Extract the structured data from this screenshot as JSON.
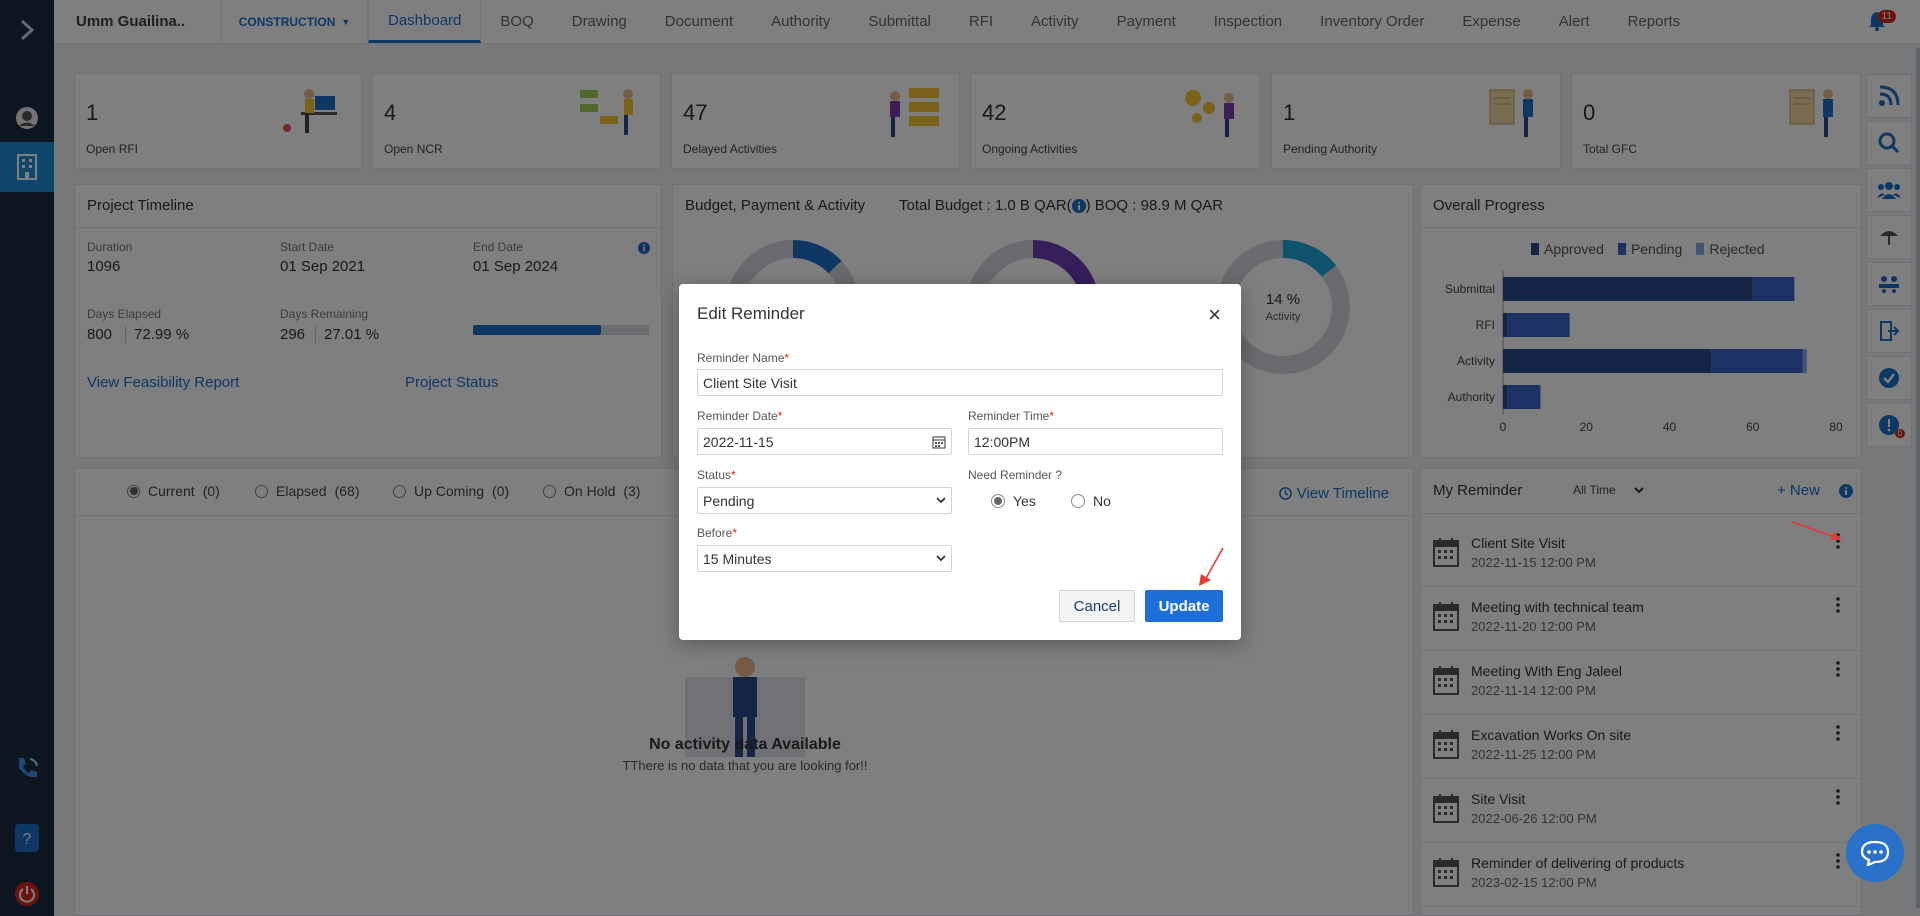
{
  "header": {
    "project_name": "Umm Guailina..",
    "project_type": "CONSTRUCTION",
    "tabs": [
      "Dashboard",
      "BOQ",
      "Drawing",
      "Document",
      "Authority",
      "Submittal",
      "RFI",
      "Activity",
      "Payment",
      "Inspection",
      "Inventory Order",
      "Expense",
      "Alert",
      "Reports"
    ],
    "notification_count": "11"
  },
  "kpis": [
    {
      "value": "1",
      "label": "Open RFI"
    },
    {
      "value": "4",
      "label": "Open NCR"
    },
    {
      "value": "47",
      "label": "Delayed Activities"
    },
    {
      "value": "42",
      "label": "Ongoing Activities"
    },
    {
      "value": "1",
      "label": "Pending Authority"
    },
    {
      "value": "0",
      "label": "Total GFC"
    }
  ],
  "timeline": {
    "title": "Project Timeline",
    "duration_label": "Duration",
    "duration": "1096",
    "start_label": "Start Date",
    "start": "01 Sep 2021",
    "end_label": "End Date",
    "end": "01 Sep 2024",
    "elapsed_label": "Days Elapsed",
    "elapsed": "800",
    "elapsed_pct": "72.99 %",
    "remaining_label": "Days Remaining",
    "remaining": "296",
    "remaining_pct": "27.01 %",
    "progress": 0.7299,
    "feasibility_link": "View Feasibility Report",
    "status_link": "Project Status"
  },
  "budget": {
    "title": "Budget, Payment & Activity",
    "total_budget": "Total Budget : 1.0 B QAR(",
    "boq": ") BOQ : 98.9 M QAR",
    "activity_pct": "14 %",
    "activity_label": "Activity"
  },
  "overall": {
    "title": "Overall Progress",
    "legend": [
      "Approved",
      "Pending",
      "Rejected"
    ],
    "colors": {
      "approved": "#2c4a8c",
      "pending": "#3a63c9",
      "rejected": "#7fa8e6"
    }
  },
  "chart_data": {
    "type": "bar",
    "orientation": "horizontal",
    "stacked": true,
    "categories": [
      "Submittal",
      "RFI",
      "Activity",
      "Authority"
    ],
    "series": [
      {
        "name": "Approved",
        "values": [
          60,
          1,
          50,
          1
        ]
      },
      {
        "name": "Pending",
        "values": [
          10,
          15,
          22,
          8
        ]
      },
      {
        "name": "Rejected",
        "values": [
          0,
          0,
          1,
          0
        ]
      }
    ],
    "xlim": [
      0,
      80
    ],
    "xticks": [
      "0",
      "20",
      "40",
      "60",
      "80"
    ],
    "legend": "top"
  },
  "activity_filter": {
    "options": [
      {
        "label": "Current",
        "count": "(0)"
      },
      {
        "label": "Elapsed",
        "count": "(68)"
      },
      {
        "label": "Up Coming",
        "count": "(0)"
      },
      {
        "label": "On Hold",
        "count": "(3)"
      }
    ],
    "view_timeline": "View Timeline",
    "empty_title": "No activity data Available",
    "empty_text": "TThere is no data that you are looking for!!"
  },
  "reminders": {
    "title": "My Reminder",
    "filter": "All Time",
    "new_label": "+ New",
    "items": [
      {
        "name": "Client Site Visit",
        "date": "2022-11-15 12:00 PM"
      },
      {
        "name": "Meeting with technical team",
        "date": "2022-11-20 12:00 PM"
      },
      {
        "name": "Meeting With Eng Jaleel",
        "date": "2022-11-14 12:00 PM"
      },
      {
        "name": "Excavation Works On site",
        "date": "2022-11-25 12:00 PM"
      },
      {
        "name": "Site Visit",
        "date": "2022-06-26 12:00 PM"
      },
      {
        "name": "Reminder of delivering of products",
        "date": "2023-02-15 12:00 PM"
      }
    ]
  },
  "modal": {
    "title": "Edit Reminder",
    "name_label": "Reminder Name",
    "name_value": "Client Site Visit",
    "date_label": "Reminder Date",
    "date_value": "2022-11-15",
    "time_label": "Reminder Time",
    "time_value": "12:00PM",
    "status_label": "Status",
    "status_value": "Pending",
    "need_label": "Need Reminder ?",
    "yes_label": "Yes",
    "no_label": "No",
    "before_label": "Before",
    "before_value": "15 Minutes",
    "cancel_label": "Cancel",
    "update_label": "Update",
    "required_mark": "*"
  },
  "toolrail": {
    "alert_badge": "0"
  }
}
